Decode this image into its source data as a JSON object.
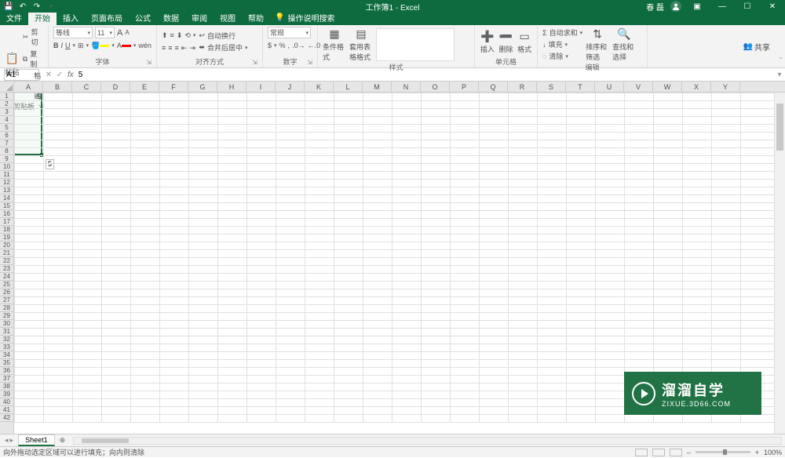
{
  "title": "工作簿1 - Excel",
  "account": {
    "name": "春 磊"
  },
  "qat": {
    "save": "💾",
    "undo": "↶",
    "redo": "↷",
    "custom": "▾"
  },
  "tabs": {
    "file": "文件",
    "home": "开始",
    "insert": "插入",
    "layout": "页面布局",
    "formulas": "公式",
    "data": "数据",
    "review": "审阅",
    "view": "视图",
    "help": "帮助",
    "tell": "操作说明搜索"
  },
  "share": "共享",
  "ribbon": {
    "clipboard": {
      "label": "剪贴板",
      "paste": "粘贴",
      "cut": "剪切",
      "copy": "复制",
      "format": "格式刷"
    },
    "font": {
      "label": "字体",
      "name": "等线",
      "size": "11",
      "grow": "A",
      "shrink": "A",
      "bold": "B",
      "italic": "I",
      "underline": "U"
    },
    "align": {
      "label": "对齐方式",
      "wrap": "自动换行",
      "merge": "合并后居中"
    },
    "number": {
      "label": "数字",
      "format": "常规"
    },
    "styles": {
      "label": "样式",
      "cond": "条件格式",
      "table": "套用表格格式"
    },
    "cells": {
      "label": "单元格",
      "insert": "插入",
      "delete": "删除",
      "format": "格式"
    },
    "editing": {
      "label": "编辑",
      "sum": "自动求和",
      "fill": "填充",
      "clear": "清除",
      "sort": "排序和筛选",
      "find": "查找和选择"
    }
  },
  "namebox": "A1",
  "formula_value": "5",
  "columns": [
    "A",
    "B",
    "C",
    "D",
    "E",
    "F",
    "G",
    "H",
    "I",
    "J",
    "K",
    "L",
    "M",
    "N",
    "O",
    "P",
    "Q",
    "R",
    "S",
    "T",
    "U",
    "V",
    "W",
    "X",
    "Y"
  ],
  "rows": 42,
  "cell_A1": "5",
  "drag_tooltip": "5",
  "sheet": {
    "name": "Sheet1"
  },
  "status": {
    "message": "向外拖动选定区域可以进行填充；向内则清除",
    "zoom": "100%"
  },
  "watermark": {
    "cn": "溜溜自学",
    "en": "ZIXUE.3D66.COM"
  }
}
